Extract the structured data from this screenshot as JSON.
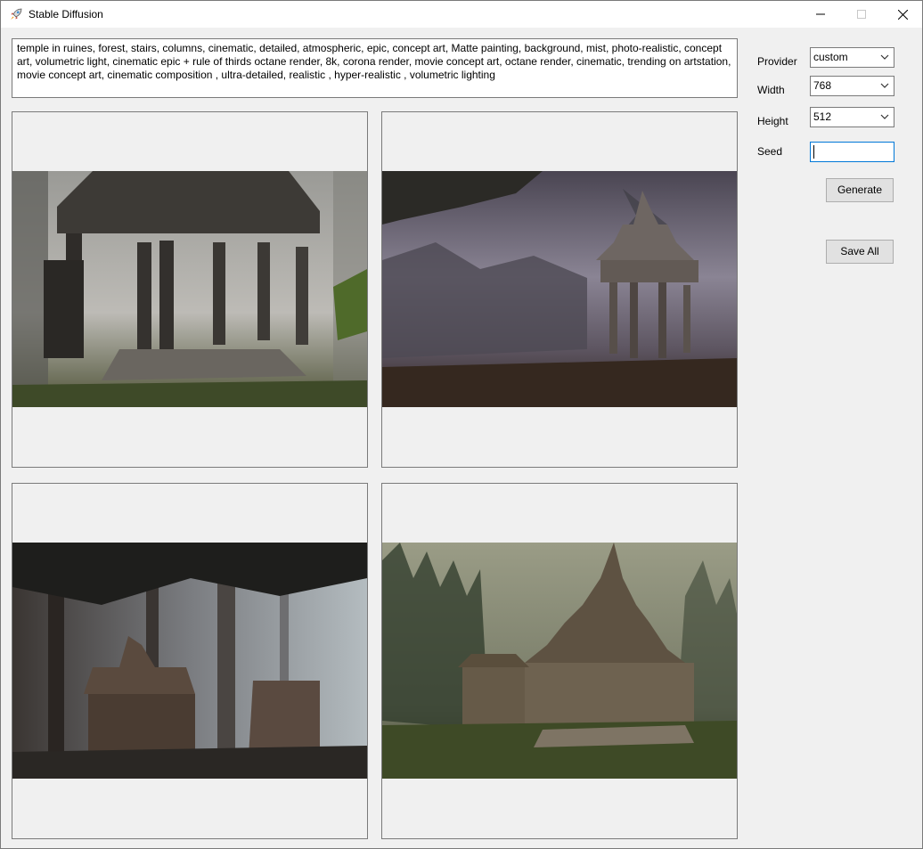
{
  "window": {
    "title": "Stable Diffusion"
  },
  "prompt": {
    "text": "temple in ruines, forest, stairs, columns, cinematic, detailed, atmospheric, epic, concept art, Matte painting, background, mist, photo-realistic, concept art, volumetric light, cinematic epic + rule of thirds octane render, 8k, corona render, movie concept art, octane render, cinematic, trending on artstation, movie concept art, cinematic composition , ultra-detailed, realistic , hyper-realistic , volumetric lighting"
  },
  "settings": {
    "provider_label": "Provider",
    "provider_value": "custom",
    "width_label": "Width",
    "width_value": "768",
    "height_label": "Height",
    "height_value": "512",
    "seed_label": "Seed",
    "seed_value": ""
  },
  "buttons": {
    "generate": "Generate",
    "save_all": "Save All"
  },
  "images": [
    {
      "name": "temple-image-1",
      "palette": [
        "#8e8c88",
        "#3a3733",
        "#4b5a2e"
      ]
    },
    {
      "name": "temple-image-2",
      "palette": [
        "#5a5560",
        "#3d3530",
        "#6a6470"
      ]
    },
    {
      "name": "temple-image-3",
      "palette": [
        "#6a7074",
        "#3a3026",
        "#2a2520"
      ]
    },
    {
      "name": "temple-image-4",
      "palette": [
        "#7e8272",
        "#5a4f3e",
        "#3e4a2a"
      ]
    }
  ]
}
